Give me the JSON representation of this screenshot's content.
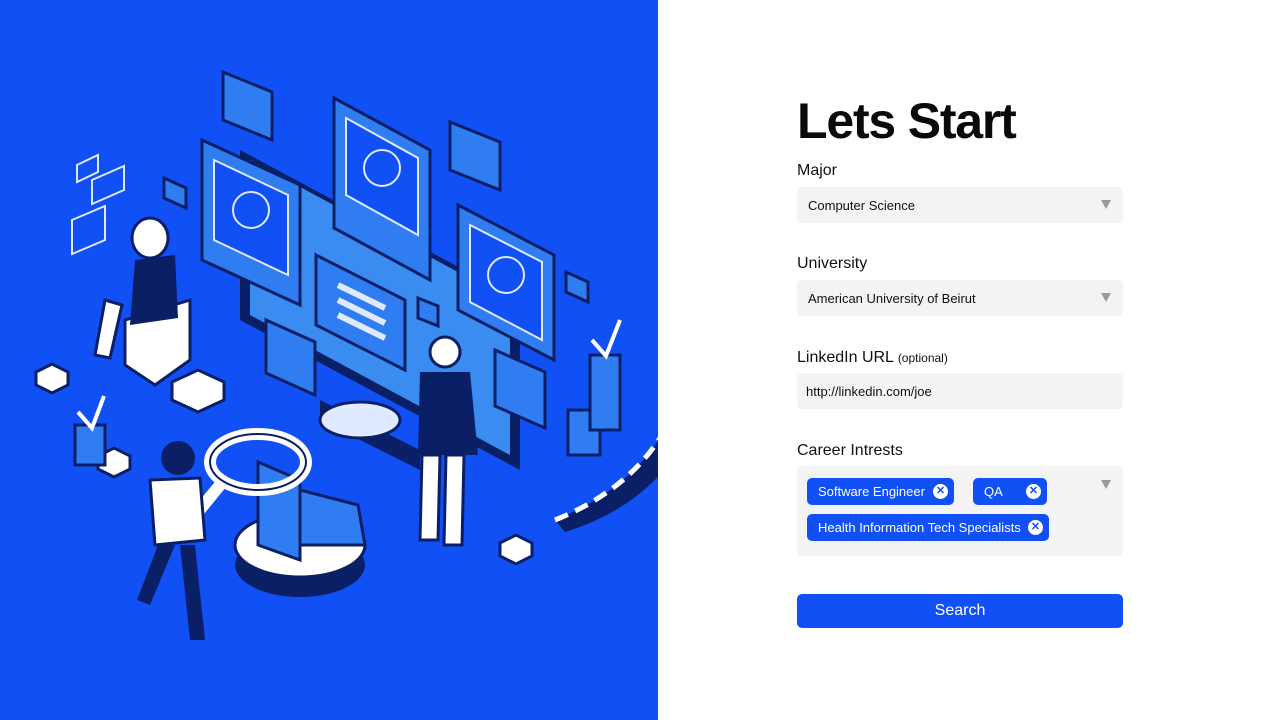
{
  "title": "Lets Start",
  "major": {
    "label": "Major",
    "value": "Computer Science"
  },
  "university": {
    "label": "University",
    "value": "American University of Beirut"
  },
  "linkedin": {
    "label": "LinkedIn URL",
    "optional": "(optional)",
    "value": "http://linkedin.com/joe"
  },
  "career": {
    "label": "Career Intrests",
    "tags": [
      "Software Engineer",
      "QA",
      "Health Information Tech Specialists"
    ],
    "remove_glyph": "✕"
  },
  "search_label": "Search",
  "colors": {
    "brand": "#1150f5",
    "field": "#f3f3f3",
    "text": "#111111"
  },
  "illustration": "isometric-recruitment-illustration"
}
